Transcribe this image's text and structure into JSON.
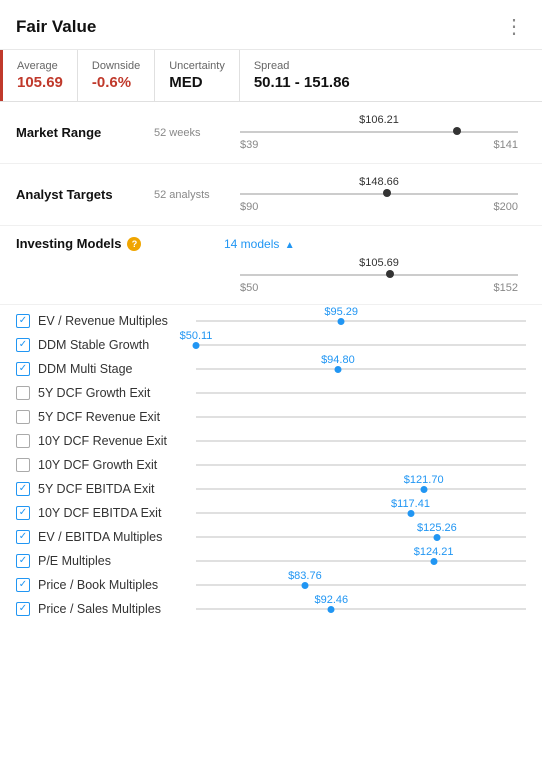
{
  "header": {
    "title": "Fair Value",
    "menu_icon": "⋮"
  },
  "metrics": [
    {
      "key": "average",
      "label": "Average",
      "value": "105.69",
      "color": "red",
      "has_left_border": true
    },
    {
      "key": "downside",
      "label": "Downside",
      "value": "-0.6%",
      "color": "red"
    },
    {
      "key": "uncertainty",
      "label": "Uncertainty",
      "value": "MED",
      "color": "dark"
    },
    {
      "key": "spread",
      "label": "Spread",
      "value": "50.11 - 151.86",
      "color": "dark"
    }
  ],
  "market_range": {
    "label": "Market Range",
    "sublabel": "52 weeks",
    "current_value": "$106.21",
    "min": "$39",
    "max": "$141",
    "dot_percent": 78
  },
  "analyst_targets": {
    "label": "Analyst Targets",
    "sublabel": "52 analysts",
    "current_value": "$148.66",
    "min": "$90",
    "max": "$200",
    "dot_percent": 53
  },
  "investing_models": {
    "label": "Investing Models",
    "info_icon": "?",
    "count_label": "14 models",
    "expand_icon": "▲",
    "current_value": "$105.69",
    "min": "$50",
    "max": "$152",
    "dot_percent": 54
  },
  "models": [
    {
      "name": "EV / Revenue Multiples",
      "checked": true,
      "value": "$95.29",
      "dot_percent": 44
    },
    {
      "name": "DDM Stable Growth",
      "checked": true,
      "value": "$50.11",
      "dot_percent": 0
    },
    {
      "name": "DDM Multi Stage",
      "checked": true,
      "value": "$94.80",
      "dot_percent": 43
    },
    {
      "name": "5Y DCF Growth Exit",
      "checked": false,
      "value": null,
      "dot_percent": null
    },
    {
      "name": "5Y DCF Revenue Exit",
      "checked": false,
      "value": null,
      "dot_percent": null
    },
    {
      "name": "10Y DCF Revenue Exit",
      "checked": false,
      "value": null,
      "dot_percent": null
    },
    {
      "name": "10Y DCF Growth Exit",
      "checked": false,
      "value": null,
      "dot_percent": null
    },
    {
      "name": "5Y DCF EBITDA Exit",
      "checked": true,
      "value": "$121.70",
      "dot_percent": 69
    },
    {
      "name": "10Y DCF EBITDA Exit",
      "checked": true,
      "value": "$117.41",
      "dot_percent": 65
    },
    {
      "name": "EV / EBITDA Multiples",
      "checked": true,
      "value": "$125.26",
      "dot_percent": 73
    },
    {
      "name": "P/E Multiples",
      "checked": true,
      "value": "$124.21",
      "dot_percent": 72
    },
    {
      "name": "Price / Book Multiples",
      "checked": true,
      "value": "$83.76",
      "dot_percent": 33
    },
    {
      "name": "Price / Sales Multiples",
      "checked": true,
      "value": "$92.46",
      "dot_percent": 41
    }
  ]
}
